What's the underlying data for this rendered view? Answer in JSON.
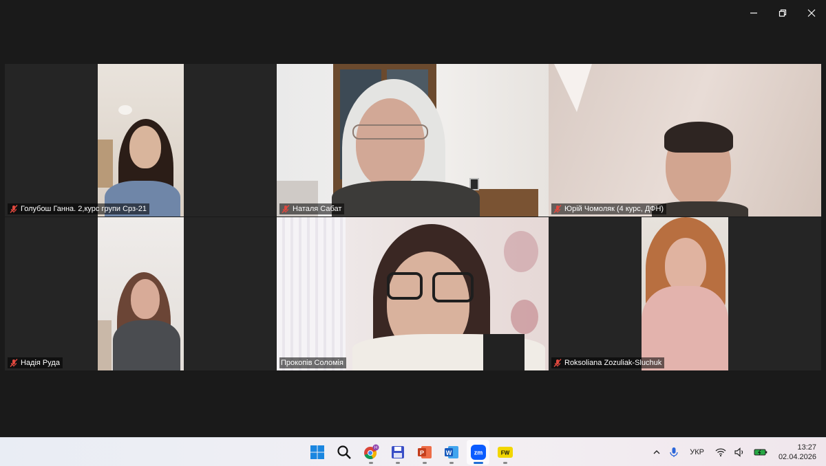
{
  "window": {
    "controls": {
      "minimize": "minimize-icon",
      "restore": "restore-icon",
      "close": "close-icon"
    }
  },
  "gallery": {
    "speaker_outline_color": "#23d959",
    "participants": [
      {
        "name": "Голубош Ганна. 2,курс  групи Срз-21",
        "muted": true
      },
      {
        "name": "Наталя Сабат",
        "muted": true
      },
      {
        "name": "Юрій Чомоляк (4 курс, ДФН)",
        "muted": true
      },
      {
        "name": "Надія Руда",
        "muted": true
      },
      {
        "name": "Прокопів Соломія",
        "muted": false,
        "active_speaker": true
      },
      {
        "name": "Roksoliana Zozuliak-Sluchuk",
        "muted": true
      }
    ]
  },
  "taskbar": {
    "apps": [
      {
        "name": "windows-start-icon"
      },
      {
        "name": "search-icon"
      },
      {
        "name": "chrome-icon",
        "badge": "H"
      },
      {
        "name": "save-icon"
      },
      {
        "name": "powerpoint-icon"
      },
      {
        "name": "word-icon"
      },
      {
        "name": "zoom-icon",
        "label": "zm",
        "active": true
      },
      {
        "name": "fw-icon",
        "label": "FW"
      }
    ],
    "tray": {
      "language": "УКР",
      "time": "13:27",
      "date": "02.04.2026"
    }
  }
}
